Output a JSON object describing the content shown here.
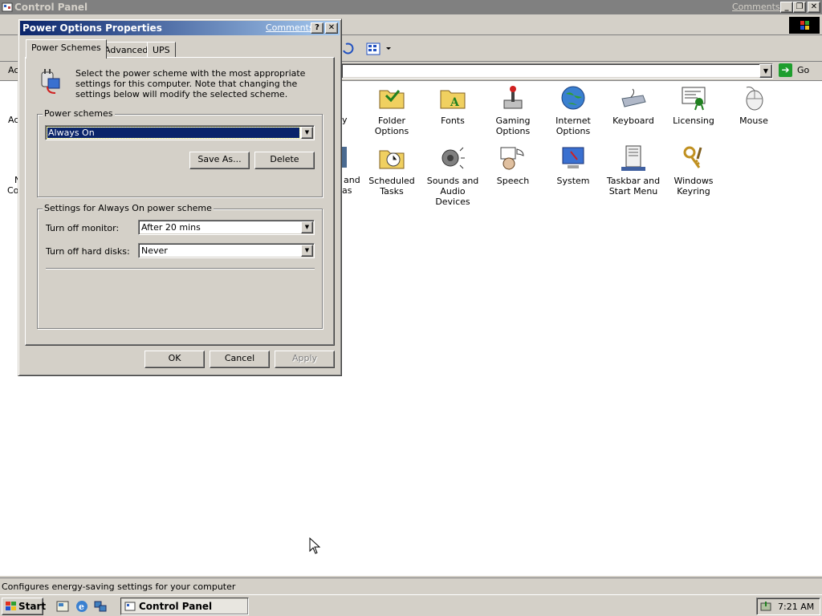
{
  "main_window": {
    "title": "Control Panel",
    "comments_link": "Comments?",
    "address_partial": "Ac",
    "go_label": "Go",
    "status_text": "Configures energy-saving settings for your computer"
  },
  "control_panel_items": [
    {
      "label": "Folder Options",
      "icon": "folder-options-icon"
    },
    {
      "label": "Fonts",
      "icon": "fonts-icon"
    },
    {
      "label": "Gaming Options",
      "icon": "gaming-options-icon"
    },
    {
      "label": "Internet Options",
      "icon": "internet-options-icon"
    },
    {
      "label": "Keyboard",
      "icon": "keyboard-icon"
    },
    {
      "label": "Licensing",
      "icon": "licensing-icon"
    },
    {
      "label": "Mouse",
      "icon": "mouse-icon"
    },
    {
      "label": "Scheduled Tasks",
      "icon": "scheduled-tasks-icon"
    },
    {
      "label": "Sounds and Audio Devices",
      "icon": "sounds-icon"
    },
    {
      "label": "Speech",
      "icon": "speech-icon"
    },
    {
      "label": "System",
      "icon": "system-icon"
    },
    {
      "label": "Taskbar and Start Menu",
      "icon": "taskbar-icon"
    },
    {
      "label": "Windows Keyring",
      "icon": "keyring-icon"
    }
  ],
  "partial_labels": {
    "left_top": "Ac",
    "left_top_2": "",
    "left_row2_a": "N",
    "left_row2_b": "Co",
    "hidden_col_r1": "y",
    "hidden_col_r2a": "and",
    "hidden_col_r2b": "as"
  },
  "dialog": {
    "title": "Power Options Properties",
    "comments_link": "Comments?",
    "help_btn": "?",
    "close_btn": "✕",
    "tabs": [
      "Power Schemes",
      "Advanced",
      "UPS"
    ],
    "active_tab": "Power Schemes",
    "description": "Select the power scheme with the most appropriate settings for this computer. Note that changing the settings below will modify the selected scheme.",
    "power_schemes_group": "Power schemes",
    "selected_scheme": "Always On",
    "save_as": "Save As...",
    "delete": "Delete",
    "settings_group": "Settings for Always On power scheme",
    "turn_off_monitor_label": "Turn off monitor:",
    "turn_off_monitor_value": "After 20 mins",
    "turn_off_disks_label": "Turn off hard disks:",
    "turn_off_disks_value": "Never",
    "ok": "OK",
    "cancel": "Cancel",
    "apply": "Apply"
  },
  "taskbar": {
    "start": "Start",
    "task_control_panel": "Control Panel",
    "clock": "7:21 AM"
  },
  "colors": {
    "dialog_title_start": "#0a246a",
    "dialog_title_end": "#a6caf0",
    "inactive_title": "#808080",
    "face": "#d4d0c8"
  }
}
